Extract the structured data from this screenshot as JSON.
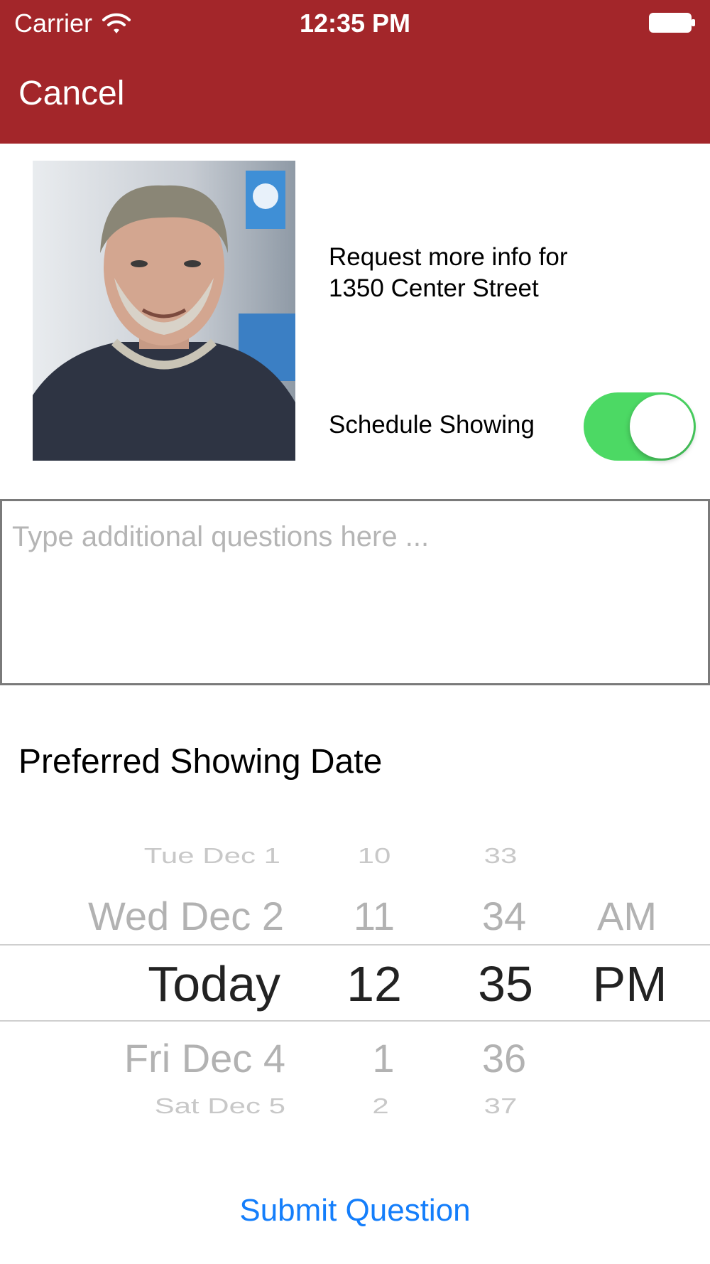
{
  "status_bar": {
    "carrier": "Carrier",
    "time": "12:35 PM"
  },
  "nav": {
    "cancel_label": "Cancel"
  },
  "request": {
    "line1": "Request more info for",
    "line2": "1350 Center Street"
  },
  "schedule": {
    "label": "Schedule Showing",
    "on": true
  },
  "questions": {
    "placeholder": "Type additional questions here ...",
    "value": ""
  },
  "preferred_title": "Preferred Showing Date",
  "picker": {
    "dates": [
      "Tue Dec 1",
      "Wed Dec 2",
      "Today",
      "Fri Dec 4",
      "Sat Dec 5"
    ],
    "hours": [
      "10",
      "11",
      "12",
      "1",
      "2"
    ],
    "minutes": [
      "33",
      "34",
      "35",
      "36",
      "37"
    ],
    "ampm": [
      "AM",
      "PM"
    ]
  },
  "submit_label": "Submit Question",
  "colors": {
    "header": "#a3262a",
    "toggle_on": "#4cd964",
    "link": "#147efb"
  }
}
